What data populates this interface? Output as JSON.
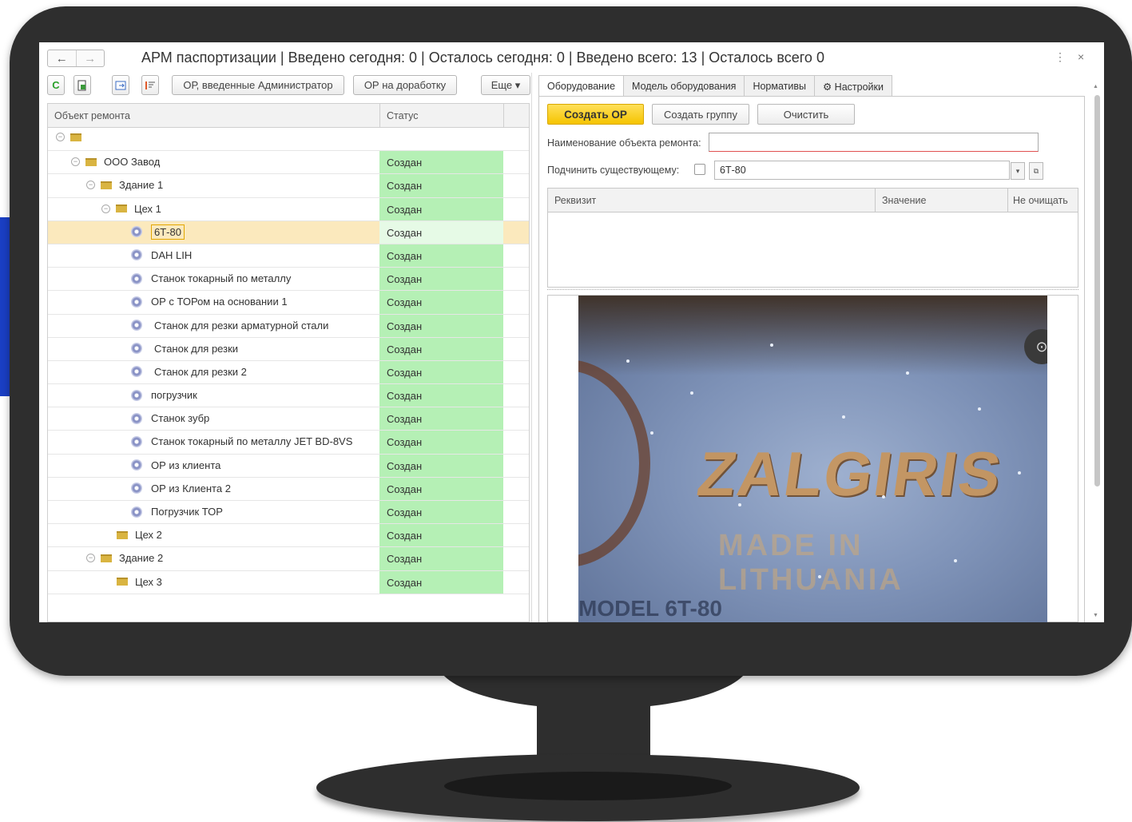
{
  "window": {
    "title": "АРМ паспортизации | Введено сегодня: 0 | Осталось сегодня: 0 | Введено всего: 13 | Осталось всего 0",
    "back_icon": "←",
    "forward_icon": "→",
    "more_icon": "⋮",
    "close_icon": "×"
  },
  "toolbar": {
    "refresh_icon": "C",
    "btn_admin": "ОР, введенные Администратор",
    "btn_rework": "ОР на доработку",
    "btn_more": "Еще ▾"
  },
  "left_table": {
    "columns": [
      "Объект ремонта",
      "Статус"
    ],
    "rows": [
      {
        "name": "",
        "status": ""
      },
      {
        "name": "ООО Завод",
        "status": "Создан"
      },
      {
        "name": "Здание 1",
        "status": "Создан"
      },
      {
        "name": "Цех 1",
        "status": "Создан"
      },
      {
        "name": "6Т-80",
        "status": "Создан"
      },
      {
        "name": "DAH LIH",
        "status": "Создан"
      },
      {
        "name": "Станок токарный по металлу",
        "status": "Создан"
      },
      {
        "name": "ОР с ТОРом на основании 1",
        "status": "Создан"
      },
      {
        "name": "Станок для резки арматурной стали",
        "status": "Создан"
      },
      {
        "name": "Станок для резки",
        "status": "Создан"
      },
      {
        "name": "Станок для резки 2",
        "status": "Создан"
      },
      {
        "name": "погрузчик",
        "status": "Создан"
      },
      {
        "name": "Станок зубр",
        "status": "Создан"
      },
      {
        "name": "Станок токарный по  металлу JET BD-8VS",
        "status": "Создан"
      },
      {
        "name": "ОР из клиента",
        "status": "Создан"
      },
      {
        "name": "ОР из Клиента 2",
        "status": "Создан"
      },
      {
        "name": "Погрузчик ТОР",
        "status": "Создан"
      },
      {
        "name": "Цех 2",
        "status": "Создан"
      },
      {
        "name": "Здание 2",
        "status": "Создан"
      },
      {
        "name": "Цех 3",
        "status": "Создан"
      }
    ]
  },
  "tabs": [
    "Оборудование",
    "Модель оборудования",
    "Нормативы",
    "⚙ Настройки"
  ],
  "equipment": {
    "btn_create": "Создать ОР",
    "btn_create_group": "Создать группу",
    "btn_clear": "Очистить",
    "name_label": "Наименование объекта ремонта:",
    "name_value": "",
    "subordinate_label": "Подчинить существующему:",
    "subordinate_value": "6Т-80",
    "dropdown_icon": "▾",
    "open_icon": "⧉",
    "props_columns": [
      "Реквизит",
      "Значение",
      "Не очищать"
    ]
  },
  "photo": {
    "brand": "ZALGIRIS",
    "made": "MADE IN LITHUANIA",
    "model": "MODEL  6T-80"
  },
  "colors": {
    "status_green": "#b5f0b5",
    "selected_row": "#fbe9bd",
    "primary_button": "#f5c400",
    "monitor": "#2e2e2e",
    "side_accent": "#1a3fc4"
  }
}
